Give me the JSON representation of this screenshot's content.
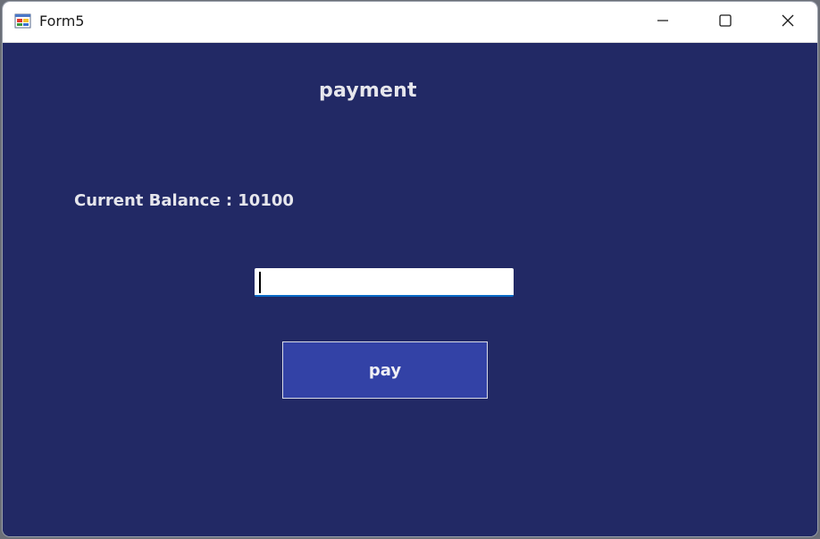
{
  "window": {
    "title": "Form5",
    "controls": {
      "minimize": "minimize-icon",
      "maximize": "maximize-icon",
      "close": "close-icon"
    }
  },
  "form": {
    "heading": "payment",
    "balance_text": "Current Balance : 10100",
    "amount_input": {
      "value": "",
      "placeholder": ""
    },
    "pay_button_label": "pay"
  },
  "colors": {
    "form_background": "#222965",
    "button_background": "#3342a6",
    "text": "#e6e6ec",
    "input_underline": "#0a6bc7"
  }
}
